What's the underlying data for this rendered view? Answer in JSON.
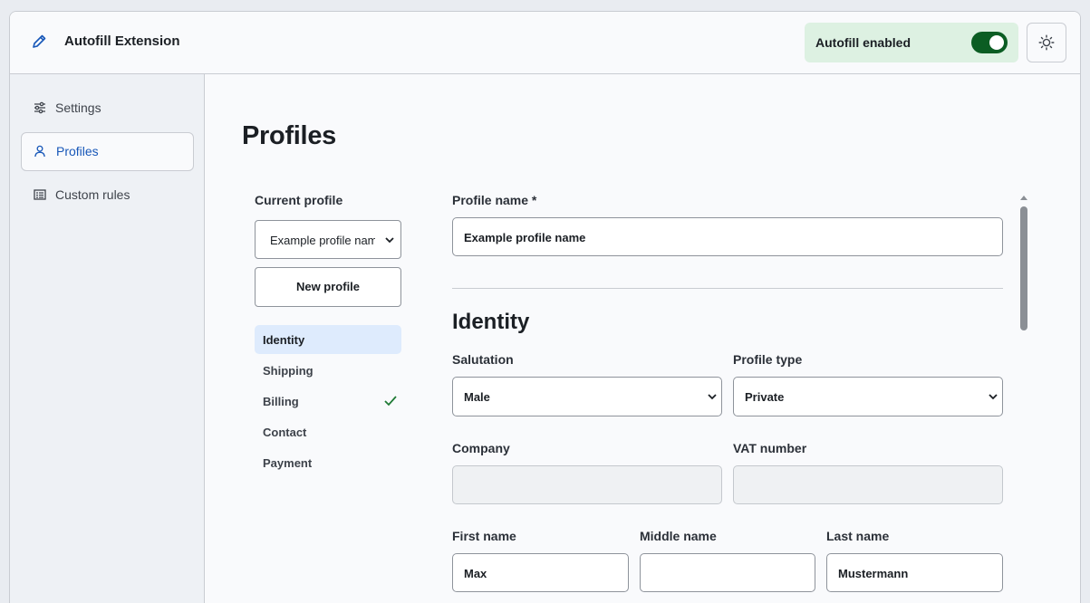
{
  "app": {
    "title": "Autofill Extension"
  },
  "header": {
    "autofill_label": "Autofill enabled",
    "autofill_enabled": true
  },
  "sidebar": {
    "items": [
      {
        "label": "Settings",
        "icon": "sliders-icon",
        "active": false
      },
      {
        "label": "Profiles",
        "icon": "user-icon",
        "active": true
      },
      {
        "label": "Custom rules",
        "icon": "list-icon",
        "active": false
      }
    ]
  },
  "main": {
    "title": "Profiles",
    "current_profile_label": "Current profile",
    "current_profile_value": "Example profile name",
    "new_profile_label": "New profile",
    "sections": [
      {
        "label": "Identity",
        "active": true,
        "complete": false
      },
      {
        "label": "Shipping",
        "active": false,
        "complete": false
      },
      {
        "label": "Billing",
        "active": false,
        "complete": true
      },
      {
        "label": "Contact",
        "active": false,
        "complete": false
      },
      {
        "label": "Payment",
        "active": false,
        "complete": false
      }
    ]
  },
  "form": {
    "profile_name_label": "Profile name *",
    "profile_name_value": "Example profile name",
    "identity_title": "Identity",
    "salutation_label": "Salutation",
    "salutation_value": "Male",
    "profile_type_label": "Profile type",
    "profile_type_value": "Private",
    "company_label": "Company",
    "company_value": "",
    "vat_label": "VAT number",
    "vat_value": "",
    "first_name_label": "First name",
    "first_name_value": "Max",
    "middle_name_label": "Middle name",
    "middle_name_value": "",
    "last_name_label": "Last name",
    "last_name_value": "Mustermann"
  },
  "colors": {
    "accent": "#1757b8",
    "toggle_on": "#0b5d23",
    "enabled_bg": "#ddf1e2",
    "check": "#1f7a35"
  }
}
